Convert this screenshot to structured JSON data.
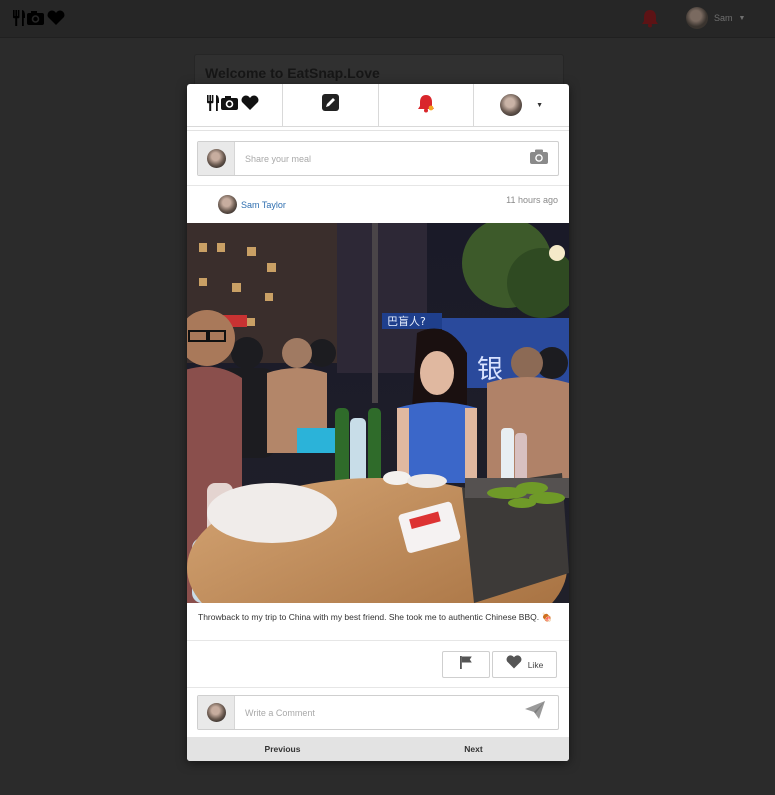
{
  "background": {
    "user_name": "Sam",
    "welcome_title": "Welcome to EatSnap.Love"
  },
  "modal": {
    "nav": {
      "logo_icon": "fork-knife-camera-heart-icon",
      "compose_icon": "pencil-icon",
      "notifications_icon": "bell-icon",
      "user_menu_icon": "avatar-caret"
    },
    "share": {
      "placeholder": "Share your meal",
      "camera_icon": "camera-icon"
    },
    "post": {
      "author": "Sam Taylor",
      "time": "11 hours ago",
      "caption": "Throwback to my trip to China with my best friend. She took me to authentic Chinese BBQ. 🍖",
      "photo_alt": "Friends at an outdoor Chinese BBQ table at night"
    },
    "actions": {
      "flag_icon": "flag-icon",
      "like_label": "Like",
      "like_icon": "heart-icon"
    },
    "comment": {
      "placeholder": "Write a Comment",
      "send_icon": "paper-plane-icon"
    },
    "pager": {
      "previous": "Previous",
      "next": "Next"
    }
  },
  "colors": {
    "accent_link": "#2f6fb0",
    "bell": "#d9262b",
    "backdrop": "#2b2b2b"
  }
}
